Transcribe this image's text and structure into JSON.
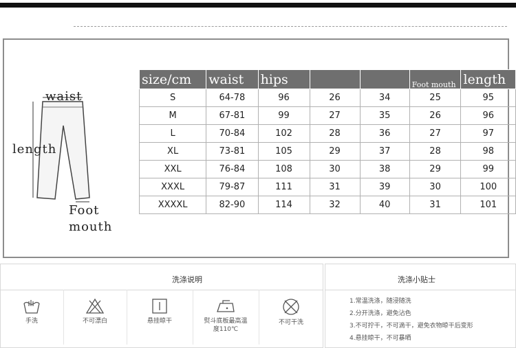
{
  "labels": {
    "waist": "waist",
    "length": "length",
    "foot_line1": "Foot",
    "foot_line2": "mouth"
  },
  "table": {
    "headers": [
      "size/cm",
      "waist",
      "hips",
      "",
      "",
      "Foot mouth",
      "length"
    ],
    "rows": [
      [
        "S",
        "64-78",
        "96",
        "26",
        "34",
        "25",
        "95"
      ],
      [
        "M",
        "67-81",
        "99",
        "27",
        "35",
        "26",
        "96"
      ],
      [
        "L",
        "70-84",
        "102",
        "28",
        "36",
        "27",
        "97"
      ],
      [
        "XL",
        "73-81",
        "105",
        "29",
        "37",
        "28",
        "98"
      ],
      [
        "XXL",
        "76-84",
        "108",
        "30",
        "38",
        "29",
        "99"
      ],
      [
        "XXXL",
        "79-87",
        "111",
        "31",
        "39",
        "30",
        "100"
      ],
      [
        "XXXXL",
        "82-90",
        "114",
        "32",
        "40",
        "31",
        "101"
      ]
    ]
  },
  "care": {
    "left_title": "洗涤说明",
    "right_title": "洗涤小贴士",
    "icons": [
      {
        "icon": "hand-wash-icon",
        "caption": "手洗"
      },
      {
        "icon": "no-bleach-icon",
        "caption": "不可漂白"
      },
      {
        "icon": "hang-dry-icon",
        "caption": "悬挂晾干"
      },
      {
        "icon": "iron-icon",
        "caption": "熨斗底板最高温度110℃"
      },
      {
        "icon": "no-dry-clean-icon",
        "caption": "不可干洗"
      }
    ],
    "tips": [
      "1.常温洗涤，随浸随洗",
      "2.分开洗涤，避免沾色",
      "3.不可拧干，不可滴干，避免衣物晾干后变形",
      "4.悬挂晾干，不可暴晒"
    ]
  }
}
